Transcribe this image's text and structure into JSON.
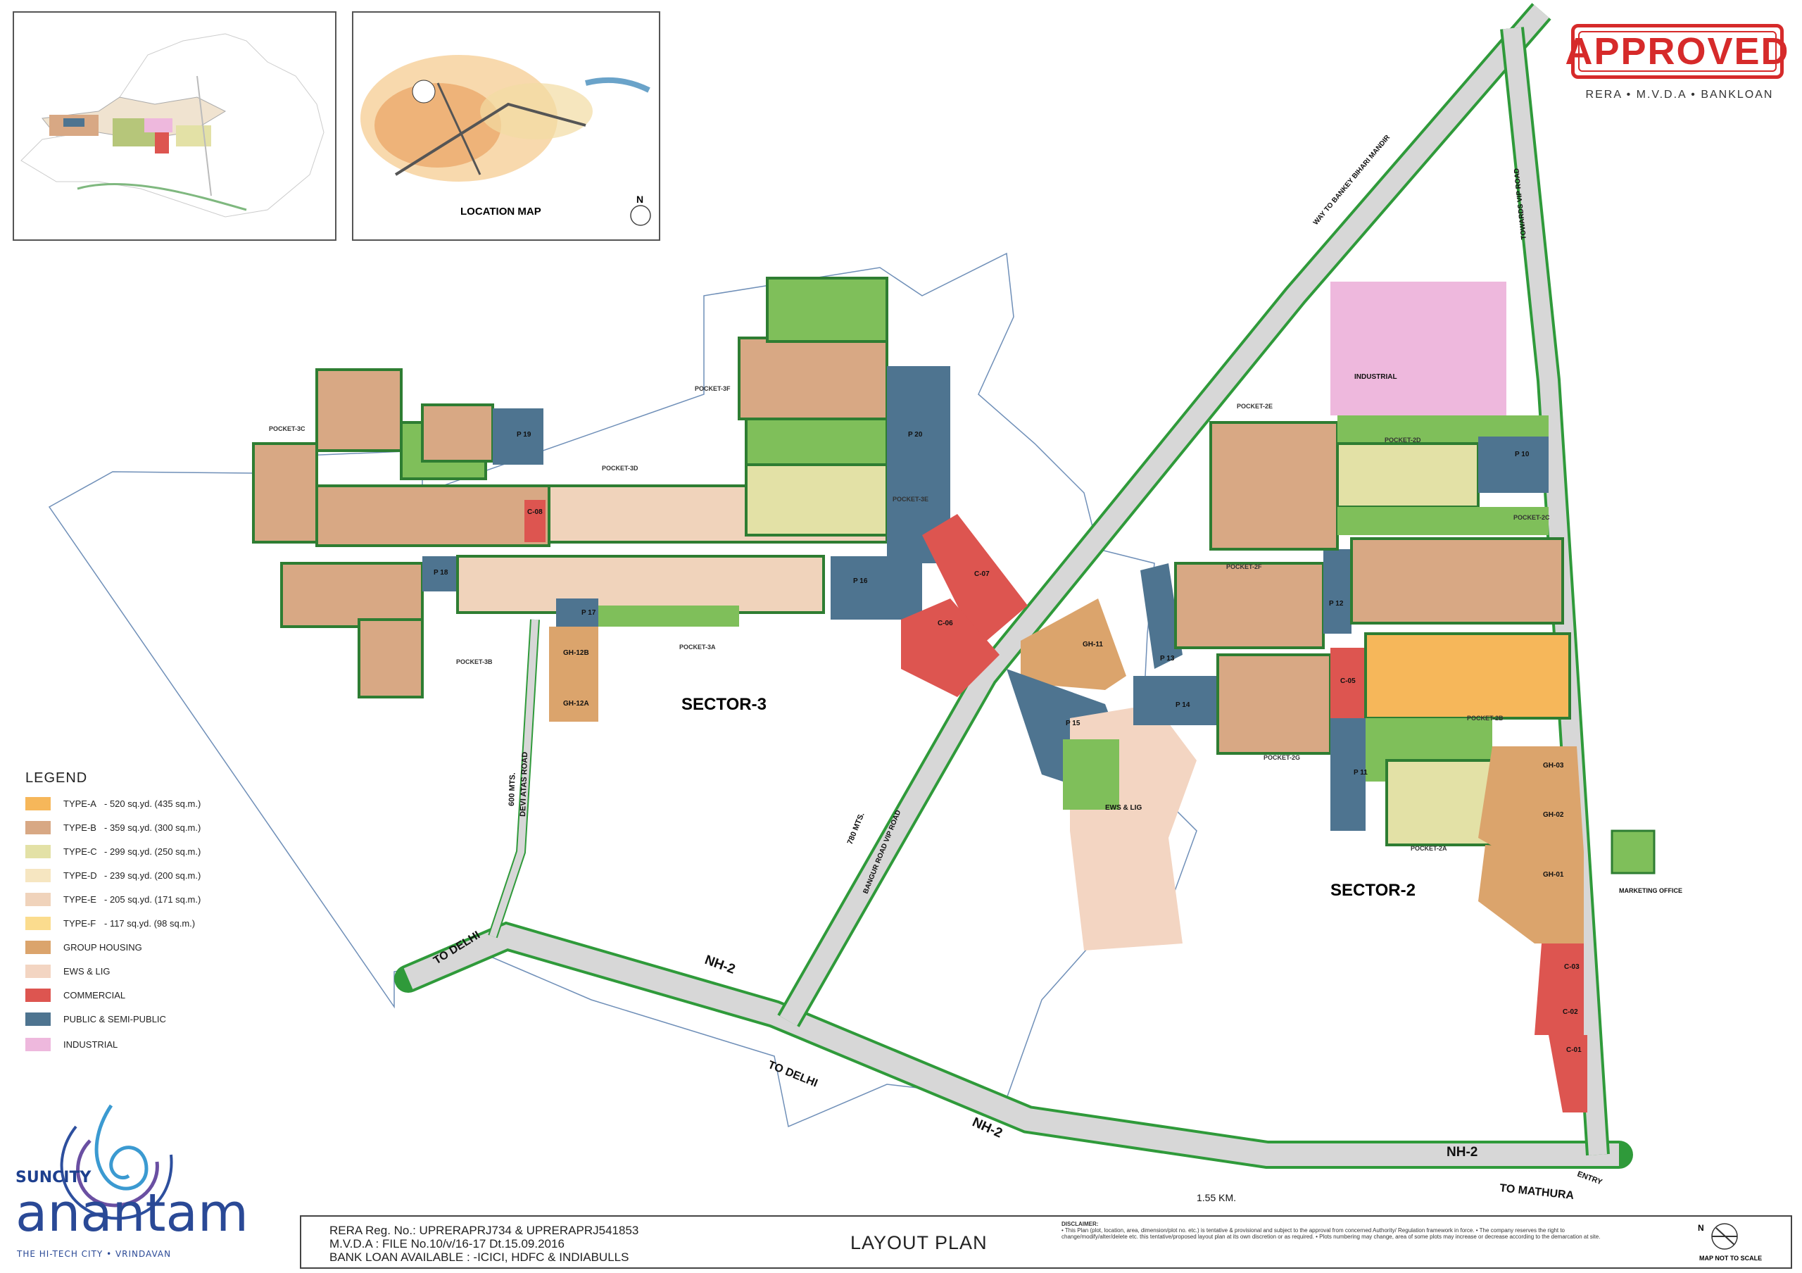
{
  "stamp": {
    "label": "APPROVED",
    "sub": "RERA • M.V.D.A • BANKLOAN"
  },
  "location_map": {
    "title": "LOCATION MAP",
    "north": "N"
  },
  "legend": {
    "title": "LEGEND",
    "items": [
      {
        "type": "TYPE-A",
        "desc": "-  520 sq.yd. (435 sq.m.)",
        "color": "#f6b75a"
      },
      {
        "type": "TYPE-B",
        "desc": "-  359 sq.yd. (300 sq.m.)",
        "color": "#d8a884"
      },
      {
        "type": "TYPE-C",
        "desc": "-  299 sq.yd. (250 sq.m.)",
        "color": "#e3e1a6"
      },
      {
        "type": "TYPE-D",
        "desc": "-  239 sq.yd. (200 sq.m.)",
        "color": "#f6e6c1"
      },
      {
        "type": "TYPE-E",
        "desc": "-  205 sq.yd. (171 sq.m.)",
        "color": "#f0d3bb"
      },
      {
        "type": "TYPE-F",
        "desc": "-  117 sq.yd. (98 sq.m.)",
        "color": "#fbdc8e"
      },
      {
        "type": "GROUP HOUSING",
        "desc": "",
        "color": "#dba46c"
      },
      {
        "type": "EWS & LIG",
        "desc": "",
        "color": "#f3d5c2"
      },
      {
        "type": "COMMERCIAL",
        "desc": "",
        "color": "#dd5550"
      },
      {
        "type": "PUBLIC & SEMI-PUBLIC",
        "desc": "",
        "color": "#4e7490"
      },
      {
        "type": "INDUSTRIAL",
        "desc": "",
        "color": "#eeb8dd"
      }
    ]
  },
  "sectors": {
    "s3": "SECTOR-3",
    "s2": "SECTOR-2"
  },
  "pockets": [
    "POCKET-3C",
    "POCKET-3D",
    "POCKET-3F",
    "POCKET-3E",
    "POCKET-3B",
    "POCKET-3A",
    "POCKET-2E",
    "POCKET-2D",
    "POCKET-2C",
    "POCKET-2F",
    "POCKET-2B",
    "POCKET-2G",
    "POCKET-2A"
  ],
  "plots": [
    "P 19",
    "P 20",
    "P 18",
    "P 17",
    "P 16",
    "P 10",
    "P 12",
    "P 13",
    "P 14",
    "P 15",
    "P 11",
    "C-08",
    "C-07",
    "C-06",
    "C-05",
    "C-03",
    "C-02",
    "C-01",
    "GH-12B",
    "GH-12A",
    "GH-11",
    "GH-03",
    "GH-02",
    "GH-01",
    "INDUSTRIAL",
    "EWS & LIG",
    "MARKETING OFFICE"
  ],
  "roads": {
    "nh2": "NH-2",
    "to_delhi": "TO DELHI",
    "to_mathura": "TO MATHURA",
    "devi_atas": "DEVI ATAS ROAD",
    "mts600": "600 MTS.",
    "mts780": "780 MTS.",
    "bangur": "BANGUR ROAD VIP ROAD",
    "bankey": "WAY TO BANKEY BIHARI MANDIR",
    "vip": "TOWARDS VIP ROAD",
    "entry": "ENTRY",
    "km": "1.55 KM."
  },
  "footer": {
    "rera": "RERA Reg. No.: UPRERAPRJ734 & UPRERAPRJ541853",
    "mvda": "M.V.D.A : FILE No.10/v/16-17 Dt.15.09.2016",
    "bank": "BANK LOAN AVAILABLE : -ICICI, HDFC & INDIABULLS",
    "title": "LAYOUT PLAN",
    "disclaimer_title": "DISCLAIMER:",
    "disclaimer": "• This Plan (plot, location, area, dimension/plot no. etc.) is tentative & provisional and subject to the approval from concerned Authority/ Regulation framework in force. • The company reserves the right to change/modify/alter/delete etc. this tentative/proposed layout plan at its own discretion or as required. • Plots numbering may change, area of some plots may increase or decrease according to the demarcation at site.",
    "north": "N",
    "not_to_scale": "MAP NOT TO SCALE"
  },
  "logo": {
    "brand": "SUNCITY",
    "name": "anantam",
    "tagline": "THE HI-TECH CITY • VRINDAVAN"
  }
}
